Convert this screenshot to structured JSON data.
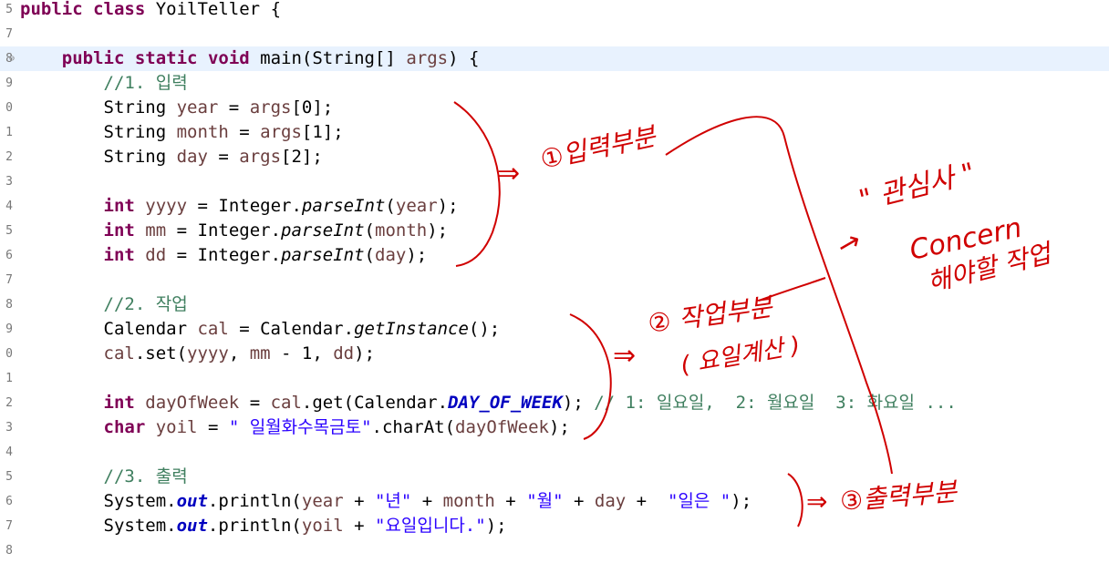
{
  "editor": {
    "lines": [
      {
        "num": "5",
        "segments": [
          {
            "t": "public",
            "c": "kw"
          },
          {
            "t": " "
          },
          {
            "t": "class",
            "c": "kw"
          },
          {
            "t": " YoilTeller {"
          }
        ]
      },
      {
        "num": "7",
        "segments": []
      },
      {
        "num": "8",
        "fold": "⊖",
        "current": true,
        "segments": [
          {
            "t": "    "
          },
          {
            "t": "public",
            "c": "kw"
          },
          {
            "t": " "
          },
          {
            "t": "static",
            "c": "kw"
          },
          {
            "t": " "
          },
          {
            "t": "void",
            "c": "kw"
          },
          {
            "t": " main(String[] "
          },
          {
            "t": "args",
            "c": "var"
          },
          {
            "t": ") {"
          }
        ]
      },
      {
        "num": "9",
        "segments": [
          {
            "t": "        "
          },
          {
            "t": "//1. 입력",
            "c": "cm"
          }
        ]
      },
      {
        "num": "0",
        "segments": [
          {
            "t": "        String "
          },
          {
            "t": "year",
            "c": "var"
          },
          {
            "t": " = "
          },
          {
            "t": "args",
            "c": "var"
          },
          {
            "t": "[0];"
          }
        ]
      },
      {
        "num": "1",
        "segments": [
          {
            "t": "        String "
          },
          {
            "t": "month",
            "c": "var"
          },
          {
            "t": " = "
          },
          {
            "t": "args",
            "c": "var"
          },
          {
            "t": "[1];"
          }
        ]
      },
      {
        "num": "2",
        "segments": [
          {
            "t": "        String "
          },
          {
            "t": "day",
            "c": "var"
          },
          {
            "t": " = "
          },
          {
            "t": "args",
            "c": "var"
          },
          {
            "t": "[2];"
          }
        ]
      },
      {
        "num": "3",
        "segments": []
      },
      {
        "num": "4",
        "segments": [
          {
            "t": "        "
          },
          {
            "t": "int",
            "c": "kw"
          },
          {
            "t": " "
          },
          {
            "t": "yyyy",
            "c": "var"
          },
          {
            "t": " = Integer."
          },
          {
            "t": "parseInt",
            "c": "ital"
          },
          {
            "t": "("
          },
          {
            "t": "year",
            "c": "var"
          },
          {
            "t": ");"
          }
        ]
      },
      {
        "num": "5",
        "segments": [
          {
            "t": "        "
          },
          {
            "t": "int",
            "c": "kw"
          },
          {
            "t": " "
          },
          {
            "t": "mm",
            "c": "var"
          },
          {
            "t": " = Integer."
          },
          {
            "t": "parseInt",
            "c": "ital"
          },
          {
            "t": "("
          },
          {
            "t": "month",
            "c": "var"
          },
          {
            "t": ");"
          }
        ]
      },
      {
        "num": "6",
        "segments": [
          {
            "t": "        "
          },
          {
            "t": "int",
            "c": "kw"
          },
          {
            "t": " "
          },
          {
            "t": "dd",
            "c": "var"
          },
          {
            "t": " = Integer."
          },
          {
            "t": "parseInt",
            "c": "ital"
          },
          {
            "t": "("
          },
          {
            "t": "day",
            "c": "var"
          },
          {
            "t": ");"
          }
        ]
      },
      {
        "num": "7",
        "segments": []
      },
      {
        "num": "8",
        "segments": [
          {
            "t": "        "
          },
          {
            "t": "//2. 작업",
            "c": "cm"
          }
        ]
      },
      {
        "num": "9",
        "segments": [
          {
            "t": "        Calendar "
          },
          {
            "t": "cal",
            "c": "var"
          },
          {
            "t": " = Calendar."
          },
          {
            "t": "getInstance",
            "c": "ital"
          },
          {
            "t": "();"
          }
        ]
      },
      {
        "num": "0",
        "segments": [
          {
            "t": "        "
          },
          {
            "t": "cal",
            "c": "var"
          },
          {
            "t": ".set("
          },
          {
            "t": "yyyy",
            "c": "var"
          },
          {
            "t": ", "
          },
          {
            "t": "mm",
            "c": "var"
          },
          {
            "t": " - 1, "
          },
          {
            "t": "dd",
            "c": "var"
          },
          {
            "t": ");"
          }
        ]
      },
      {
        "num": "1",
        "segments": []
      },
      {
        "num": "2",
        "segments": [
          {
            "t": "        "
          },
          {
            "t": "int",
            "c": "kw"
          },
          {
            "t": " "
          },
          {
            "t": "dayOfWeek",
            "c": "var"
          },
          {
            "t": " = "
          },
          {
            "t": "cal",
            "c": "var"
          },
          {
            "t": ".get(Calendar."
          },
          {
            "t": "DAY_OF_WEEK",
            "c": "fld"
          },
          {
            "t": "); "
          },
          {
            "t": "// 1: 일요일,  2: 월요일  3: 화요일 ...",
            "c": "cm"
          }
        ]
      },
      {
        "num": "3",
        "segments": [
          {
            "t": "        "
          },
          {
            "t": "char",
            "c": "kw"
          },
          {
            "t": " "
          },
          {
            "t": "yoil",
            "c": "var"
          },
          {
            "t": " = "
          },
          {
            "t": "\" 일월화수목금토\"",
            "c": "str"
          },
          {
            "t": ".charAt("
          },
          {
            "t": "dayOfWeek",
            "c": "var"
          },
          {
            "t": ");"
          }
        ]
      },
      {
        "num": "4",
        "segments": []
      },
      {
        "num": "5",
        "segments": [
          {
            "t": "        "
          },
          {
            "t": "//3. 출력",
            "c": "cm"
          }
        ]
      },
      {
        "num": "6",
        "segments": [
          {
            "t": "        System."
          },
          {
            "t": "out",
            "c": "fld"
          },
          {
            "t": ".println("
          },
          {
            "t": "year",
            "c": "var"
          },
          {
            "t": " + "
          },
          {
            "t": "\"년\"",
            "c": "str"
          },
          {
            "t": " + "
          },
          {
            "t": "month",
            "c": "var"
          },
          {
            "t": " + "
          },
          {
            "t": "\"월\"",
            "c": "str"
          },
          {
            "t": " + "
          },
          {
            "t": "day",
            "c": "var"
          },
          {
            "t": " +  "
          },
          {
            "t": "\"일은 \"",
            "c": "str"
          },
          {
            "t": ");"
          }
        ]
      },
      {
        "num": "7",
        "segments": [
          {
            "t": "        System."
          },
          {
            "t": "out",
            "c": "fld"
          },
          {
            "t": ".println("
          },
          {
            "t": "yoil",
            "c": "var"
          },
          {
            "t": " + "
          },
          {
            "t": "\"요일입니다.\"",
            "c": "str"
          },
          {
            "t": ");"
          }
        ]
      },
      {
        "num": "8",
        "segments": []
      }
    ]
  },
  "annotations": {
    "input_arrow": "⇒",
    "input_label": "①입력부분",
    "work_arrow": "⇒",
    "work_label": "② 작업부분",
    "work_sub": "( 요일계산 )",
    "output_arrow": "⇒",
    "output_label": "③출력부분",
    "concern_quote": "\" 관심사 \"",
    "concern_en": "Concern",
    "concern_note": "해야할 작업",
    "concern_arrow": "→"
  },
  "colors": {
    "keyword": "#7f0055",
    "comment": "#3f7f5f",
    "string": "#2a00ff",
    "field": "#0000c0",
    "variable": "#6a3e3e",
    "current_line": "#e8f2fe",
    "ink": "#d00000"
  }
}
